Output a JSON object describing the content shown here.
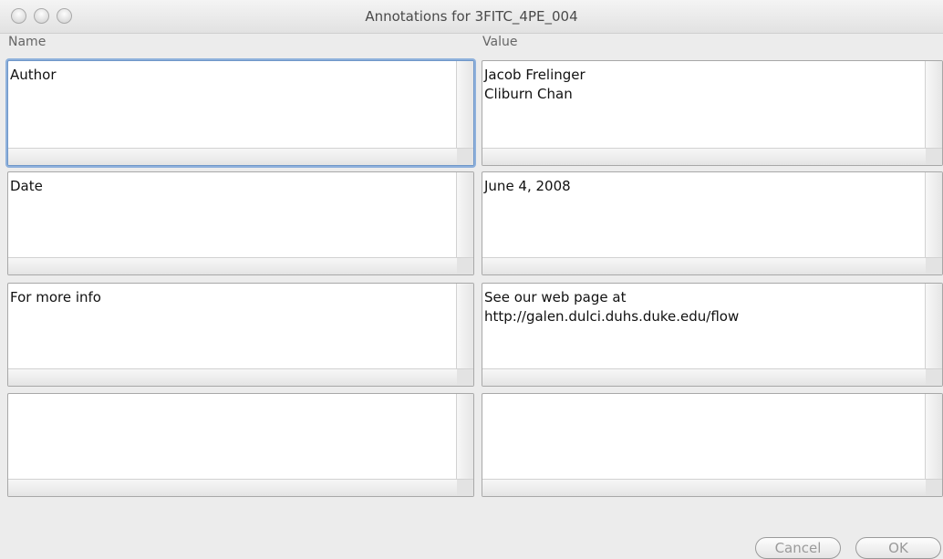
{
  "window": {
    "title": "Annotations for 3FITC_4PE_004"
  },
  "columns": {
    "name": "Name",
    "value": "Value"
  },
  "rows": [
    {
      "name": "Author",
      "value": "Jacob Frelinger\nCliburn Chan"
    },
    {
      "name": "Date",
      "value": "June 4, 2008"
    },
    {
      "name": "For more info",
      "value": "See our web page at\nhttp://galen.dulci.duhs.duke.edu/flow"
    },
    {
      "name": "",
      "value": ""
    }
  ],
  "buttons": {
    "cancel": "Cancel",
    "ok": "OK"
  }
}
